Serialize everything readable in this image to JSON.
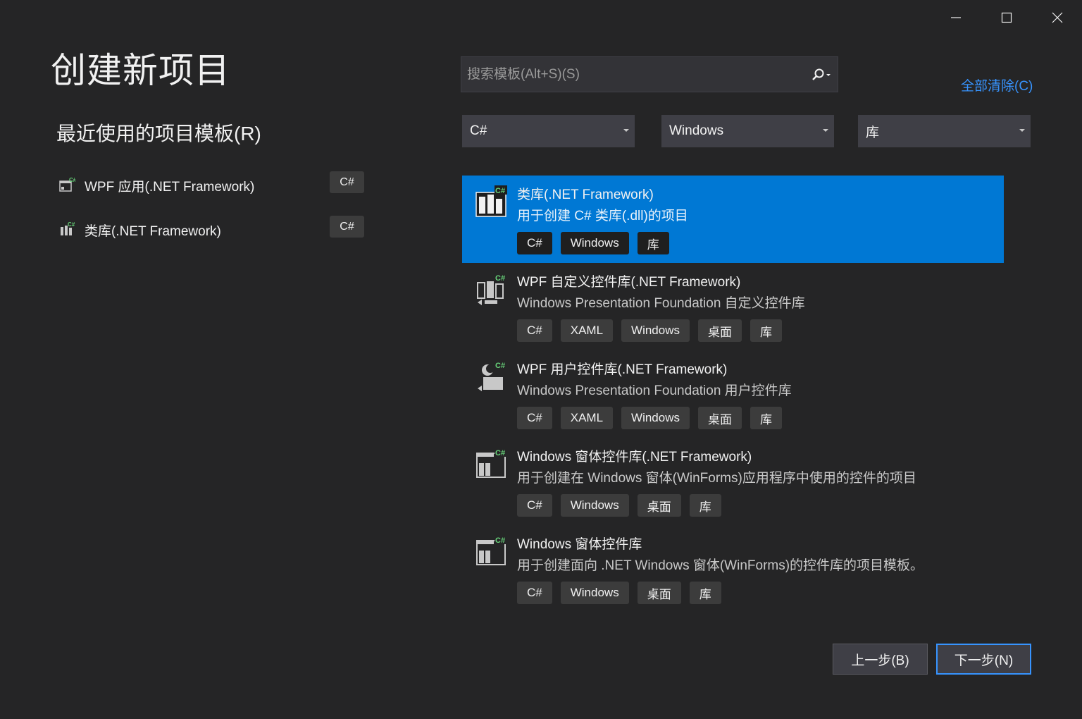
{
  "window": {
    "minimize_icon": "minimize-icon",
    "maximize_icon": "maximize-icon",
    "close_icon": "close-icon"
  },
  "page_title": "创建新项目",
  "recent": {
    "title": "最近使用的项目模板(R)",
    "items": [
      {
        "label": "WPF 应用(.NET Framework)",
        "lang": "C#",
        "icon": "wpf-app-icon"
      },
      {
        "label": "类库(.NET Framework)",
        "lang": "C#",
        "icon": "class-library-icon"
      }
    ]
  },
  "search": {
    "placeholder": "搜索模板(Alt+S)(S)",
    "value": "",
    "icon": "search-icon"
  },
  "clear_all": "全部清除(C)",
  "filters": {
    "language": "C#",
    "platform": "Windows",
    "project_type": "库"
  },
  "templates": [
    {
      "name": "类库(.NET Framework)",
      "description": "用于创建 C# 类库(.dll)的项目",
      "tags": [
        "C#",
        "Windows",
        "库"
      ],
      "selected": true,
      "icon": "class-library-icon"
    },
    {
      "name": "WPF 自定义控件库(.NET Framework)",
      "description": "Windows Presentation Foundation 自定义控件库",
      "tags": [
        "C#",
        "XAML",
        "Windows",
        "桌面",
        "库"
      ],
      "selected": false,
      "icon": "wpf-custom-control-library-icon"
    },
    {
      "name": "WPF 用户控件库(.NET Framework)",
      "description": "Windows Presentation Foundation 用户控件库",
      "tags": [
        "C#",
        "XAML",
        "Windows",
        "桌面",
        "库"
      ],
      "selected": false,
      "icon": "wpf-user-control-library-icon"
    },
    {
      "name": "Windows 窗体控件库(.NET Framework)",
      "description": "用于创建在 Windows 窗体(WinForms)应用程序中使用的控件的项目",
      "tags": [
        "C#",
        "Windows",
        "桌面",
        "库"
      ],
      "selected": false,
      "icon": "winforms-control-library-icon"
    },
    {
      "name": "Windows 窗体控件库",
      "description": "用于创建面向 .NET Windows 窗体(WinForms)的控件库的项目模板。",
      "tags": [
        "C#",
        "Windows",
        "桌面",
        "库"
      ],
      "selected": false,
      "icon": "winforms-control-library-icon"
    }
  ],
  "buttons": {
    "back": "上一步(B)",
    "next": "下一步(N)"
  },
  "colors": {
    "background": "#252526",
    "accent": "#0078d4",
    "link": "#3794ff",
    "csharp_badge": "#68d37a"
  }
}
